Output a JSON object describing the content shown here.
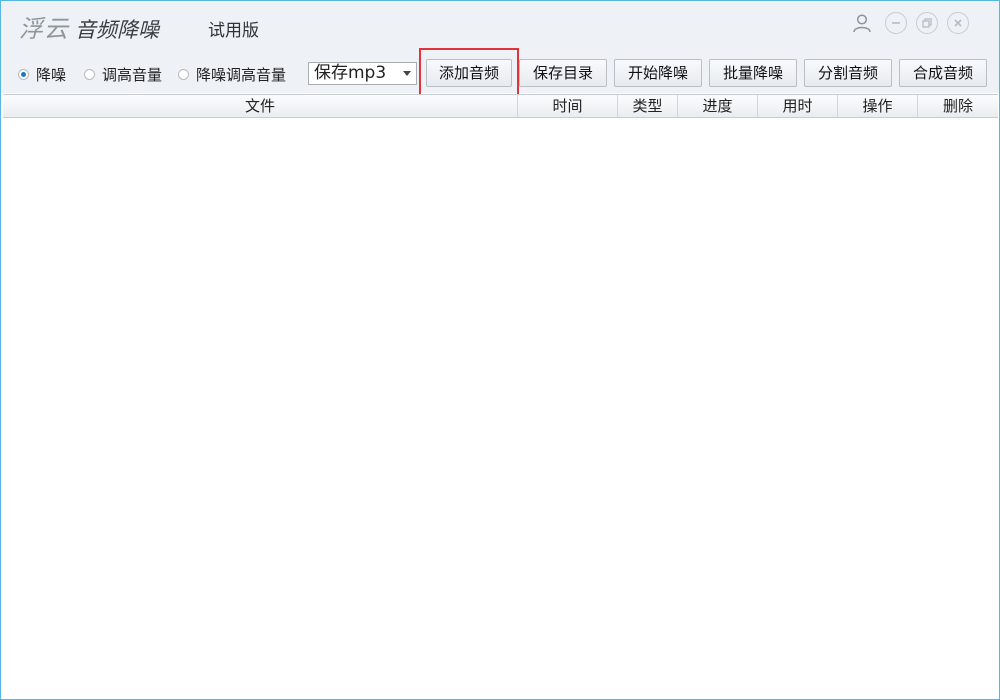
{
  "window": {
    "app_name_light": "浮云",
    "app_name_strong": "音频降噪",
    "edition": "试用版",
    "controls": {
      "user": "user-icon",
      "minimize": "minimize-icon",
      "maximize": "restore-icon",
      "close": "close-icon"
    }
  },
  "toolbar": {
    "modes": [
      {
        "label": "降噪",
        "checked": true
      },
      {
        "label": "调高音量",
        "checked": false
      },
      {
        "label": "降噪调高音量",
        "checked": false
      }
    ],
    "format_select": "保存mp3",
    "buttons": [
      "添加音频",
      "保存目录",
      "开始降噪",
      "批量降噪",
      "分割音频",
      "合成音频"
    ],
    "highlighted_button": "添加音频"
  },
  "table": {
    "columns": [
      "文件",
      "时间",
      "类型",
      "进度",
      "用时",
      "操作",
      "删除"
    ],
    "rows": []
  },
  "colors": {
    "highlight": "#e0343a",
    "accent": "#1f78c1",
    "border": "#58b6e4"
  }
}
